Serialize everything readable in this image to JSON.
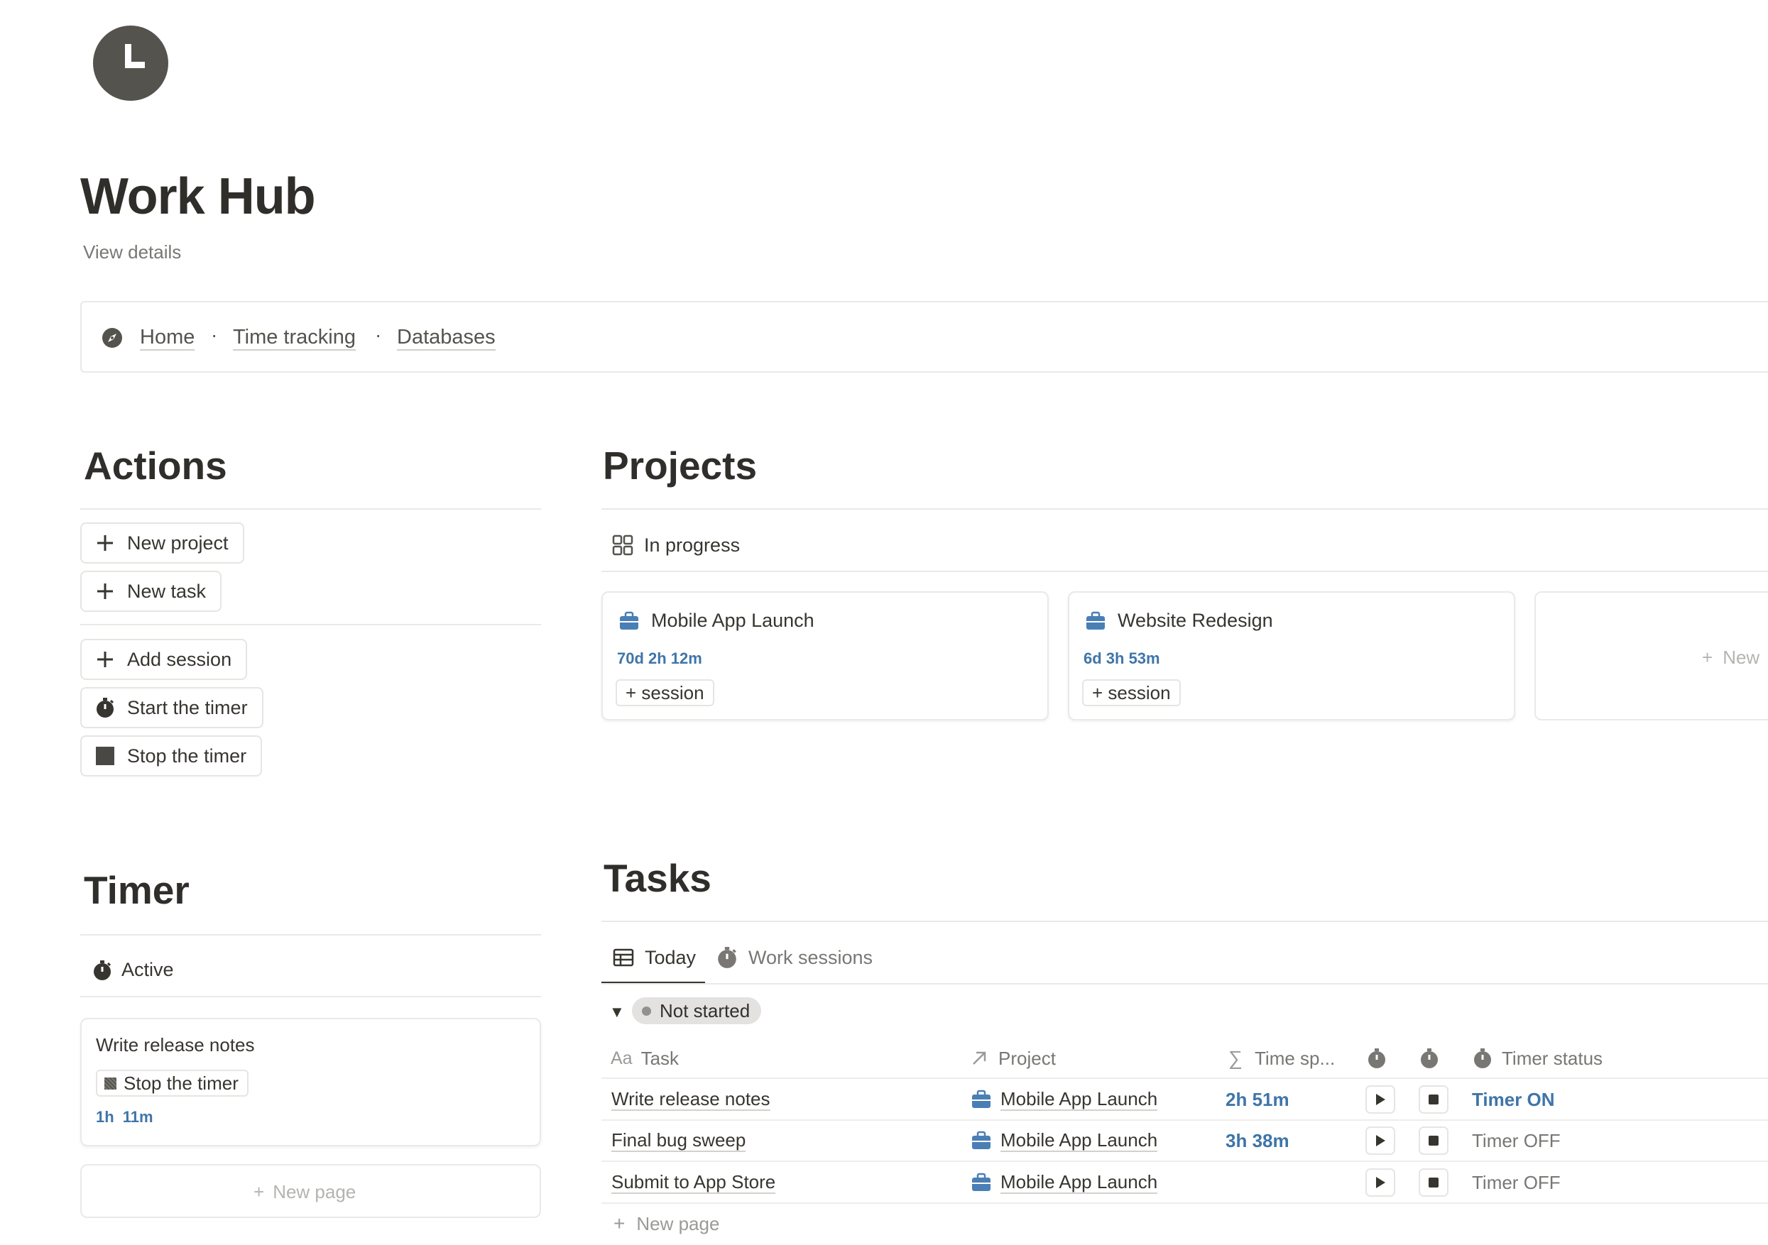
{
  "page": {
    "icon": "clock-icon",
    "title": "Work Hub",
    "view_details": "View details"
  },
  "nav": {
    "icon": "compass-icon",
    "links": [
      "Home",
      "Time tracking",
      "Databases"
    ],
    "separator": "·"
  },
  "actions": {
    "heading": "Actions",
    "buttons": [
      {
        "label": "New project",
        "icon": "plus-icon"
      },
      {
        "label": "New task",
        "icon": "plus-icon"
      },
      {
        "label": "Add session",
        "icon": "plus-icon"
      },
      {
        "label": "Start the timer",
        "icon": "stopwatch-icon"
      },
      {
        "label": "Stop the timer",
        "icon": "stop-square-icon"
      }
    ]
  },
  "projects": {
    "heading": "Projects",
    "view": {
      "label": "In progress",
      "icon": "gallery-icon"
    },
    "cards": [
      {
        "title": "Mobile App Launch",
        "duration": "70d 2h 12m",
        "button": "+ session",
        "icon": "briefcase-icon"
      },
      {
        "title": "Website Redesign",
        "duration": "6d 3h 53m",
        "button": "+ session",
        "icon": "briefcase-icon"
      }
    ],
    "new_label": "New"
  },
  "timer": {
    "heading": "Timer",
    "view": {
      "label": "Active",
      "icon": "stopwatch-icon"
    },
    "card": {
      "title": "Write release notes",
      "button": "Stop the timer",
      "duration": "1h 11m"
    },
    "new_page": "New page"
  },
  "tasks": {
    "heading": "Tasks",
    "tabs": [
      {
        "label": "Today",
        "icon": "table-icon",
        "active": true
      },
      {
        "label": "Work sessions",
        "icon": "stopwatch-icon",
        "active": false
      }
    ],
    "group": {
      "label": "Not started"
    },
    "columns": {
      "task": "Task",
      "task_icon": "Aa",
      "project": "Project",
      "time": "Time sp...",
      "status": "Timer status"
    },
    "rows": [
      {
        "task": "Write release notes",
        "project": "Mobile App Launch",
        "time": "2h 51m",
        "status": "Timer ON",
        "on": true
      },
      {
        "task": "Final bug sweep",
        "project": "Mobile App Launch",
        "time": "3h 38m",
        "status": "Timer OFF",
        "on": false
      },
      {
        "task": "Submit to App Store",
        "project": "Mobile App Launch",
        "time": "",
        "status": "Timer OFF",
        "on": false
      }
    ],
    "new_page": "New page"
  },
  "colors": {
    "text": "#37352f",
    "accent_blue": "#3f75a8",
    "icon_gray": "#55534e",
    "briefcase_blue": "#4a7fb5"
  }
}
